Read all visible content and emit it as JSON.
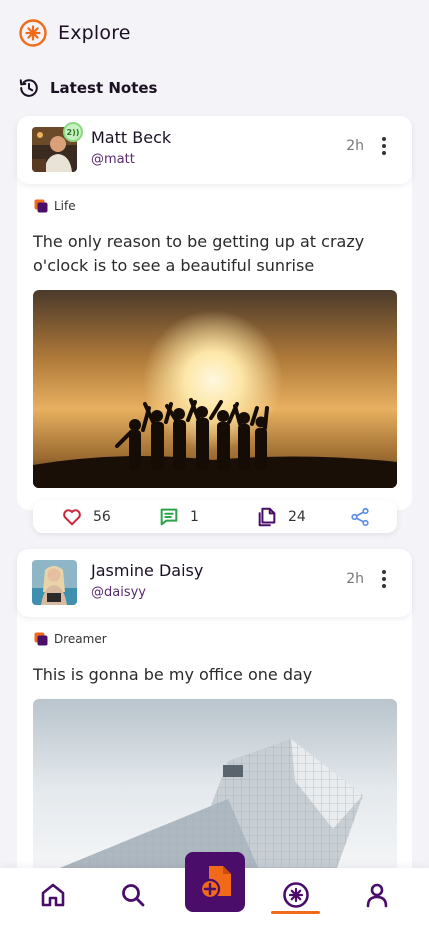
{
  "header": {
    "title": "Explore"
  },
  "section": {
    "title": "Latest Notes"
  },
  "posts": [
    {
      "name": "Matt Beck",
      "handle": "@matt",
      "time": "2h",
      "badge": "2))",
      "category": "Life",
      "text": "The only reason to be getting up at crazy o'clock is to see a beautiful sunrise",
      "likes": "56",
      "comments": "1",
      "copies": "24"
    },
    {
      "name": "Jasmine Daisy",
      "handle": "@daisyy",
      "time": "2h",
      "category": "Dreamer",
      "text": "This is gonna be my office one day"
    }
  ],
  "colors": {
    "accent": "#f06a1a",
    "brand": "#4a0d6a",
    "like": "#c8283a",
    "comment": "#2aa34a",
    "share": "#5b8ee6"
  },
  "icons": {
    "header": "explore-icon",
    "section": "history-icon",
    "nav": [
      "home-icon",
      "search-icon",
      "new-note-icon",
      "explore-icon",
      "profile-icon"
    ]
  }
}
